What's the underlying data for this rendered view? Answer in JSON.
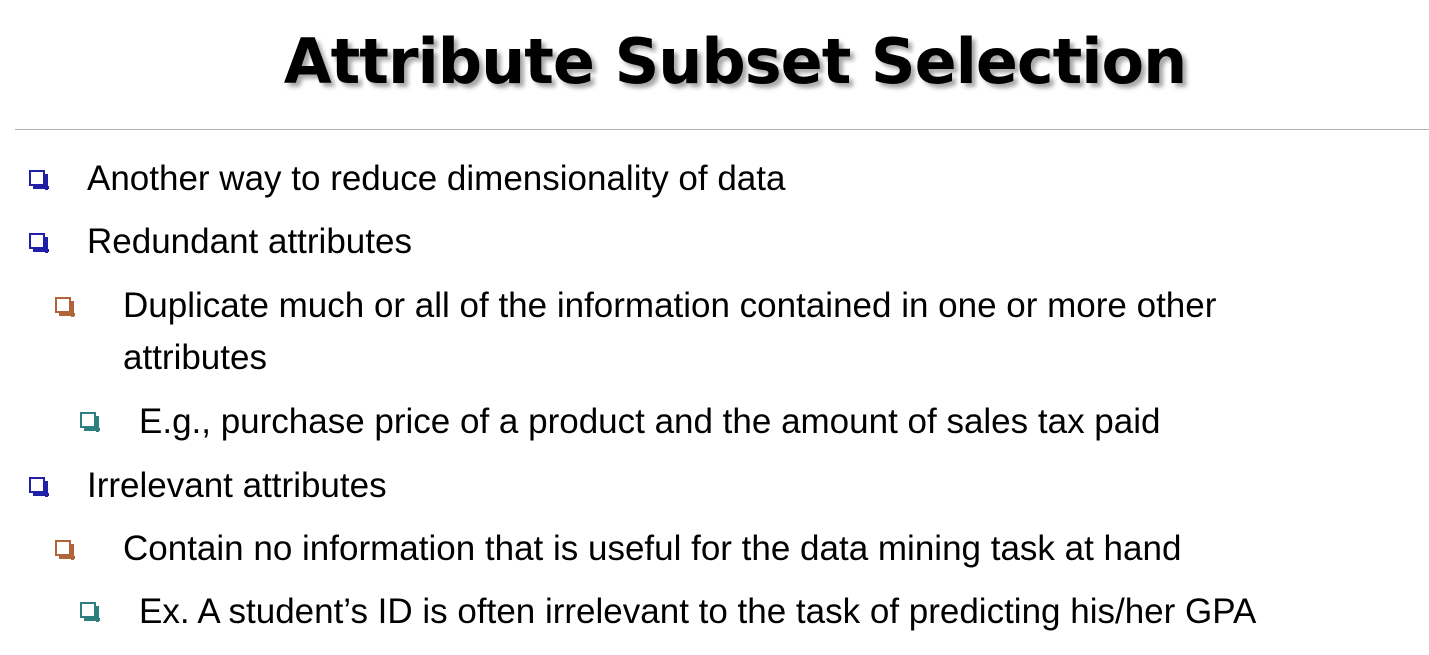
{
  "slide": {
    "title": "Attribute Subset Selection",
    "bullets": [
      {
        "level": 1,
        "text": "Another way to reduce dimensionality of data"
      },
      {
        "level": 1,
        "text": "Redundant attributes"
      },
      {
        "level": 2,
        "text": "Duplicate much or all of the information contained in one or more other"
      },
      {
        "level": 2,
        "text": "attributes"
      },
      {
        "level": 3,
        "text": "E.g., purchase price of a product and the amount of sales tax paid"
      },
      {
        "level": 1,
        "text": "Irrelevant attributes"
      },
      {
        "level": 2,
        "text": "Contain no information that is useful for the data mining task at hand"
      },
      {
        "level": 3,
        "text": "Ex. A student’s ID is often irrelevant to the task of predicting his/her GPA"
      }
    ]
  },
  "colors": {
    "level1_bullet": "#1f1fa8",
    "level2_bullet": "#b0643a",
    "level3_bullet": "#2f7f7f",
    "divider": "#b4b4b4"
  },
  "icons": {
    "bullet": "hollow-square-bullet-icon"
  }
}
